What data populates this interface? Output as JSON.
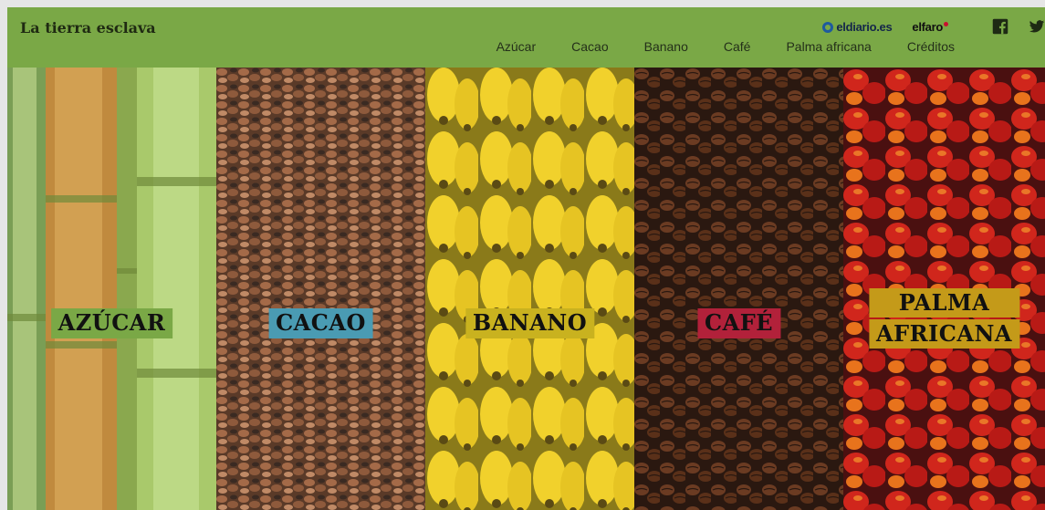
{
  "header": {
    "site_title": "La tierra esclava",
    "brands": {
      "eldiario": "eldiario.es",
      "elfaro": "elfaro"
    },
    "social": [
      {
        "icon": "facebook-icon"
      },
      {
        "icon": "twitter-icon"
      }
    ],
    "nav": [
      "Azúcar",
      "Cacao",
      "Banano",
      "Café",
      "Palma africana",
      "Créditos"
    ]
  },
  "panels": [
    {
      "label": "AZÚCAR",
      "label_color": "#7aa846",
      "image": "sugarcane-stalks"
    },
    {
      "label": "CACAO",
      "label_color": "#4a9bb3",
      "image": "cacao-beans"
    },
    {
      "label": "BANANO",
      "label_color": "#c9b21f",
      "image": "bananas"
    },
    {
      "label": "CAFÉ",
      "label_color": "#b2213a",
      "image": "coffee-beans"
    },
    {
      "label_lines": [
        "PALMA",
        "AFRICANA"
      ],
      "label_color": "#c49a19",
      "image": "palm-fruit"
    }
  ],
  "colors": {
    "header_bg": "#7aa846"
  }
}
